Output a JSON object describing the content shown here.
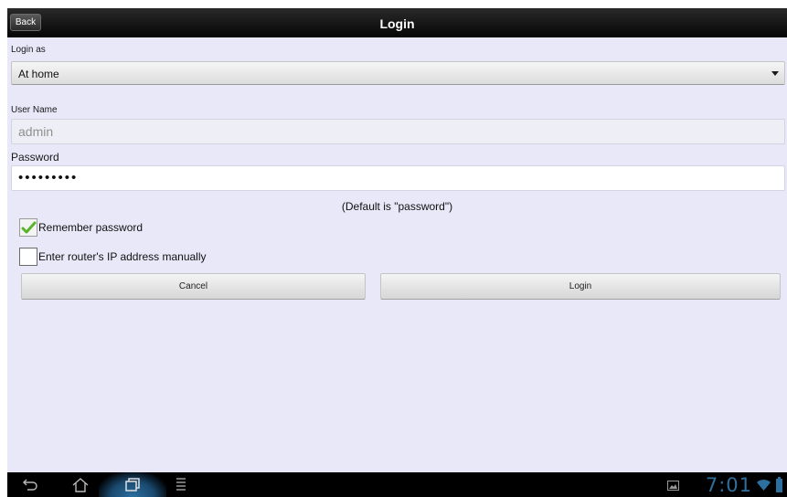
{
  "header": {
    "back_label": "Back",
    "title": "Login"
  },
  "form": {
    "login_as_label": "Login as",
    "login_as_value": "At home",
    "username_label": "User Name",
    "username_value": "admin",
    "password_label": "Password",
    "password_value": "•••••••••",
    "hint": "(Default is \"password\")",
    "remember_label": "Remember password",
    "remember_checked": true,
    "manual_ip_label": "Enter router's IP address manually",
    "manual_ip_checked": false
  },
  "actions": {
    "cancel_label": "Cancel",
    "login_label": "Login"
  },
  "statusbar": {
    "time": "7:01"
  },
  "colors": {
    "background": "#e8e8f8",
    "titlebar": "#000000",
    "check_green": "#5ab42a",
    "clock": "#2d6f9f"
  },
  "icons": {
    "back": "back-arrow-icon",
    "home": "home-icon",
    "recents": "recent-apps-icon",
    "menu": "menu-icon",
    "gallery": "gallery-icon",
    "wifi": "wifi-icon",
    "battery": "battery-icon"
  }
}
